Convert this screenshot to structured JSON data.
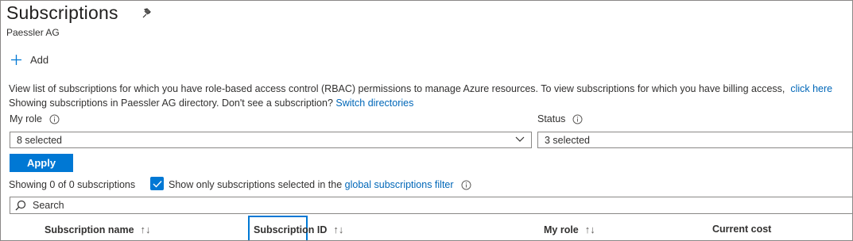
{
  "header": {
    "title": "Subscriptions",
    "subtitle": "Paessler AG"
  },
  "toolbar": {
    "add_label": "Add"
  },
  "description": {
    "line1": "View list of subscriptions for which you have role-based access control (RBAC) permissions to manage Azure resources. To view subscriptions for which you have billing access,",
    "line1_link": "click here",
    "line2": "Showing subscriptions in Paessler AG directory. Don't see a subscription?",
    "line2_link": "Switch directories"
  },
  "filters": {
    "my_role_label": "My role",
    "my_role_value": "8 selected",
    "status_label": "Status",
    "status_value": "3 selected",
    "apply_label": "Apply"
  },
  "summary": {
    "showing_text": "Showing 0 of 0 subscriptions",
    "checkbox_checked": true,
    "checkbox_label": "Show only subscriptions selected in the",
    "checkbox_link": "global subscriptions filter"
  },
  "search": {
    "placeholder": "Search"
  },
  "table": {
    "columns": [
      {
        "label": "Subscription name",
        "sortable": true
      },
      {
        "label": "Subscription ID",
        "sortable": true,
        "focused": true
      },
      {
        "label": "My role",
        "sortable": true
      },
      {
        "label": "Current cost",
        "sortable": false
      }
    ]
  },
  "colors": {
    "accent": "#0078d4",
    "link": "#0067b8",
    "border": "#8a8886"
  }
}
